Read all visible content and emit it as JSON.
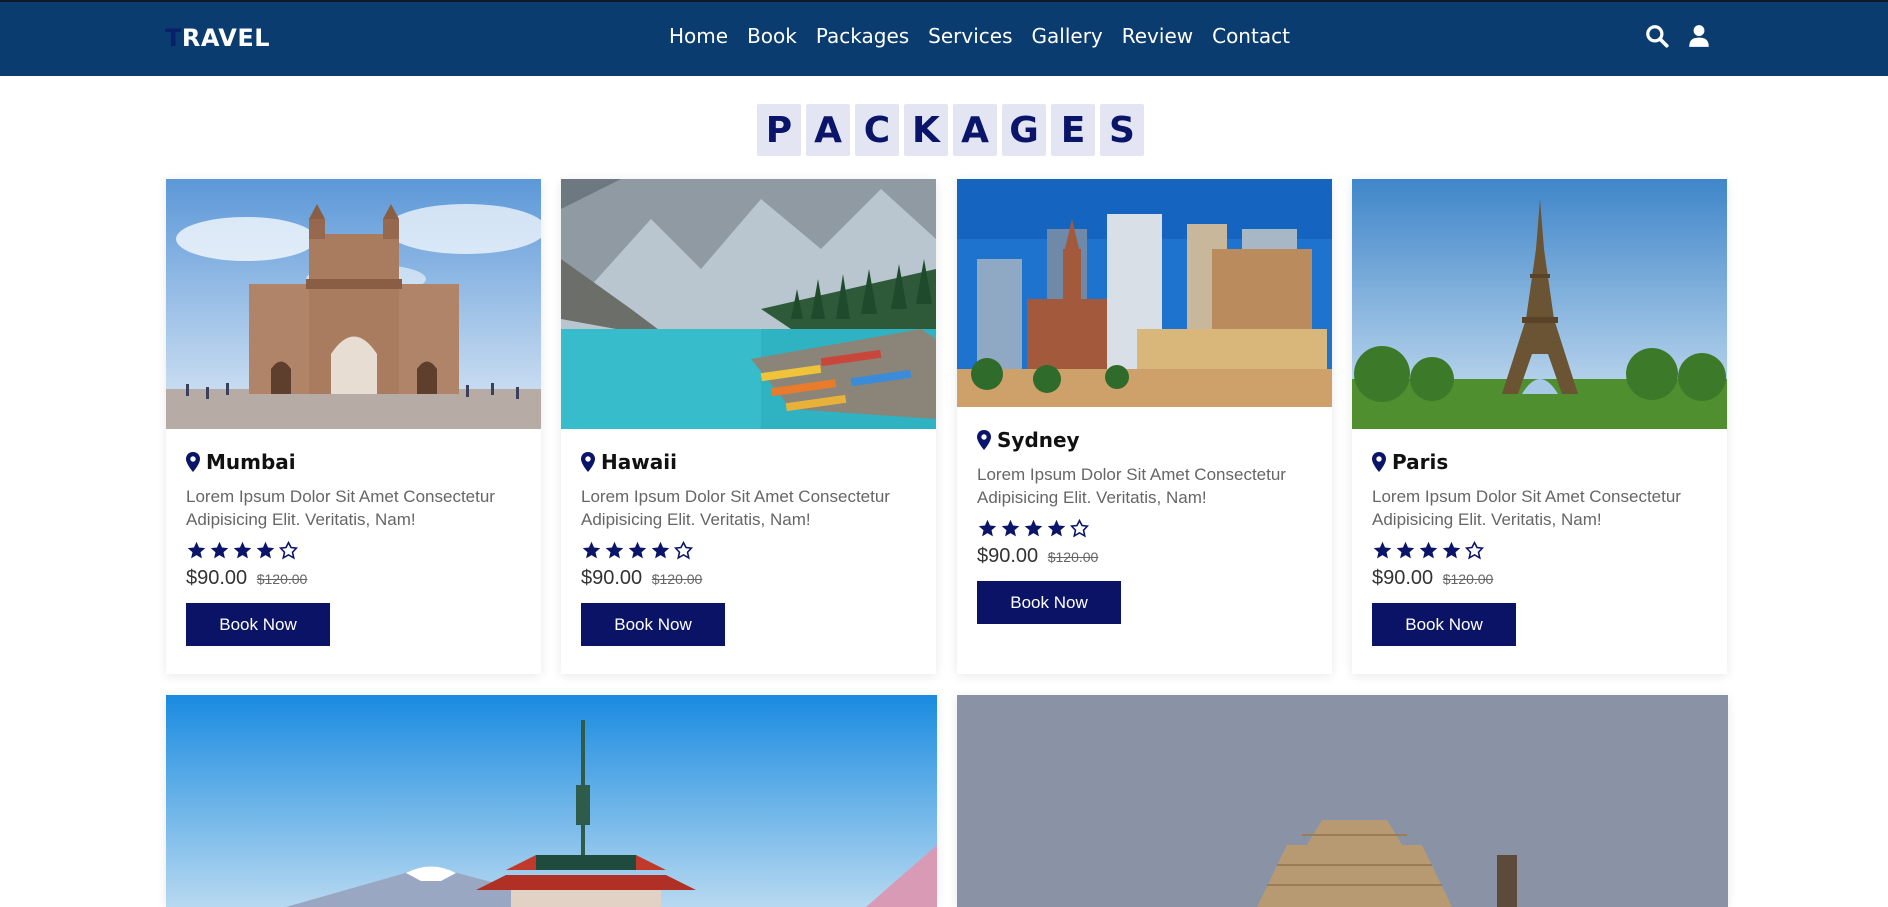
{
  "brand": {
    "first_letter": "T",
    "rest": "RAVEL"
  },
  "nav": {
    "items": [
      "Home",
      "Book",
      "Packages",
      "Services",
      "Gallery",
      "Review",
      "Contact"
    ]
  },
  "header_icons": [
    "search-icon",
    "user-icon"
  ],
  "section": {
    "letters": [
      "P",
      "A",
      "C",
      "K",
      "A",
      "G",
      "E",
      "S"
    ]
  },
  "colors": {
    "header": "#0b3c6f",
    "accent": "#0a1366",
    "title_tile": "#e3e5f3"
  },
  "packages": [
    {
      "place": "Mumbai",
      "description": "Lorem Ipsum Dolor Sit Amet Consectetur Adipisicing Elit. Veritatis, Nam!",
      "rating": 4,
      "rating_max": 5,
      "price": "$90.00",
      "old_price": "$120.00",
      "button": "Book Now"
    },
    {
      "place": "Hawaii",
      "description": "Lorem Ipsum Dolor Sit Amet Consectetur Adipisicing Elit. Veritatis, Nam!",
      "rating": 4,
      "rating_max": 5,
      "price": "$90.00",
      "old_price": "$120.00",
      "button": "Book Now"
    },
    {
      "place": "Sydney",
      "description": "Lorem Ipsum Dolor Sit Amet Consectetur Adipisicing Elit. Veritatis, Nam!",
      "rating": 4,
      "rating_max": 5,
      "price": "$90.00",
      "old_price": "$120.00",
      "button": "Book Now"
    },
    {
      "place": "Paris",
      "description": "Lorem Ipsum Dolor Sit Amet Consectetur Adipisicing Elit. Veritatis, Nam!",
      "rating": 4,
      "rating_max": 5,
      "price": "$90.00",
      "old_price": "$120.00",
      "button": "Book Now"
    }
  ]
}
